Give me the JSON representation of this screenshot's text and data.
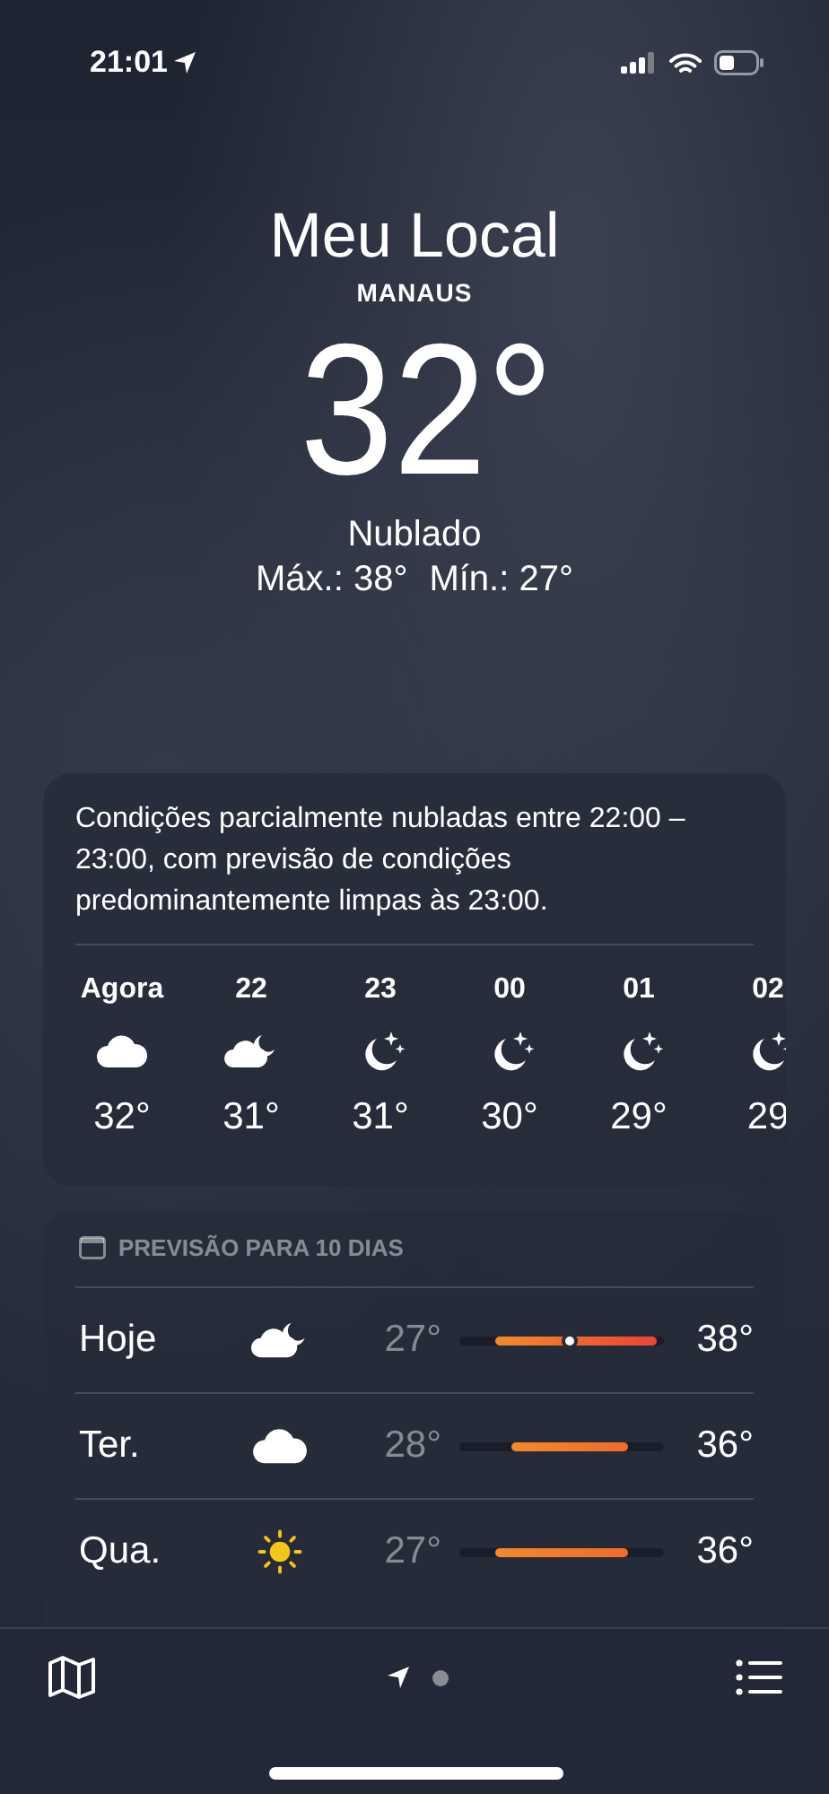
{
  "status_bar": {
    "time": "21:01"
  },
  "header": {
    "title": "Meu Local",
    "city": "MANAUS",
    "temperature": "32°",
    "condition": "Nublado",
    "high": "Máx.: 38°",
    "low": "Mín.: 27°"
  },
  "hourly": {
    "summary": "Condições parcialmente nubladas entre 22:00 – 23:00, com previsão de condições predominantemente limpas às 23:00.",
    "hours": [
      {
        "time": "Agora",
        "kind": "cloud",
        "temp": "32°"
      },
      {
        "time": "22",
        "kind": "cloud-moon",
        "temp": "31°"
      },
      {
        "time": "23",
        "kind": "moon",
        "temp": "31°"
      },
      {
        "time": "00",
        "kind": "moon",
        "temp": "30°"
      },
      {
        "time": "01",
        "kind": "moon",
        "temp": "29°"
      },
      {
        "time": "02",
        "kind": "moon",
        "temp": "29"
      }
    ]
  },
  "daily": {
    "title": "PREVISÃO PARA 10 DIAS",
    "days": [
      {
        "day": "Hoje",
        "kind": "cloud-moon",
        "low": "27°",
        "high": "38°",
        "current_marker": true
      },
      {
        "day": "Ter.",
        "kind": "cloud",
        "low": "28°",
        "high": "36°",
        "current_marker": false
      },
      {
        "day": "Qua.",
        "kind": "sun",
        "low": "27°",
        "high": "36°",
        "current_marker": false
      }
    ]
  },
  "page_indicator": [
    {
      "kind": "location",
      "selected": true
    },
    {
      "kind": "dot",
      "selected": false
    }
  ]
}
